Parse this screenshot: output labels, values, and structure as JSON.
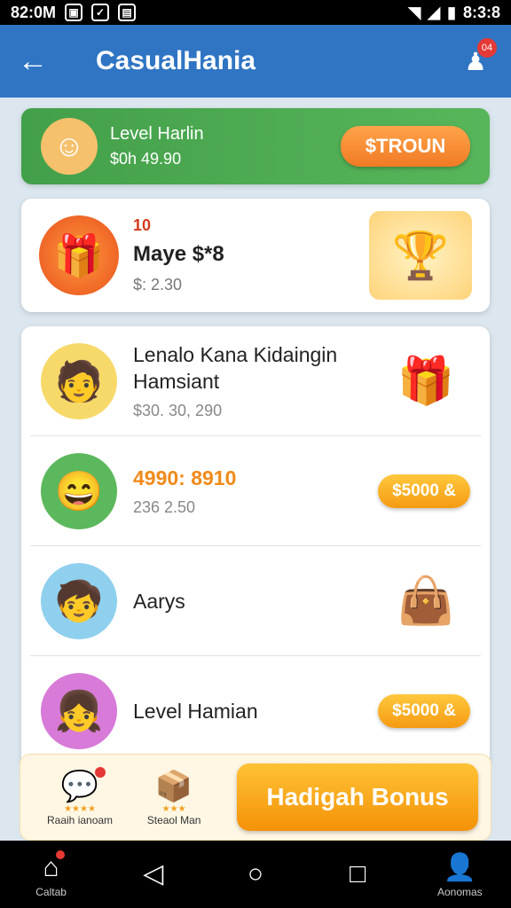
{
  "status_bar": {
    "time": "82:0M",
    "clock_right": "8:3:8"
  },
  "app_bar": {
    "title": "CasualHania",
    "notification_count": "04"
  },
  "header_card": {
    "title": "Level Harlin",
    "subtitle": "$0h 49.90",
    "button": "$TROUN"
  },
  "gift_card": {
    "number": "10",
    "title": "Maye $*8",
    "subtitle": "$: 2.30"
  },
  "list": [
    {
      "title": "Lenalo Kana Kidaingin Hamsiant",
      "subtitle": "$30. 30, 290",
      "icon": "gift-box-icon",
      "pill": ""
    },
    {
      "title": "4990: 8910",
      "subtitle": "236 2.50",
      "icon": "",
      "pill": "$5000 &"
    },
    {
      "title": "Aarys",
      "subtitle": "",
      "icon": "gift-bag-icon",
      "pill": ""
    },
    {
      "title": "Level Hamian",
      "subtitle": "",
      "icon": "",
      "pill": "$5000 &"
    }
  ],
  "bottom_panel": {
    "item1": {
      "label": "Raaih ianoam",
      "stars": "★★★★"
    },
    "item2": {
      "label": "Steaol Man",
      "stars": "★★★"
    },
    "bonus_button": "Hadigah Bonus"
  },
  "nav": {
    "home_label": "Caltab",
    "profile_label": "Aonomas"
  },
  "colors": {
    "app_bar": "#2f75c4",
    "green_card": "#4caf50",
    "accent_orange": "#f5a623"
  }
}
